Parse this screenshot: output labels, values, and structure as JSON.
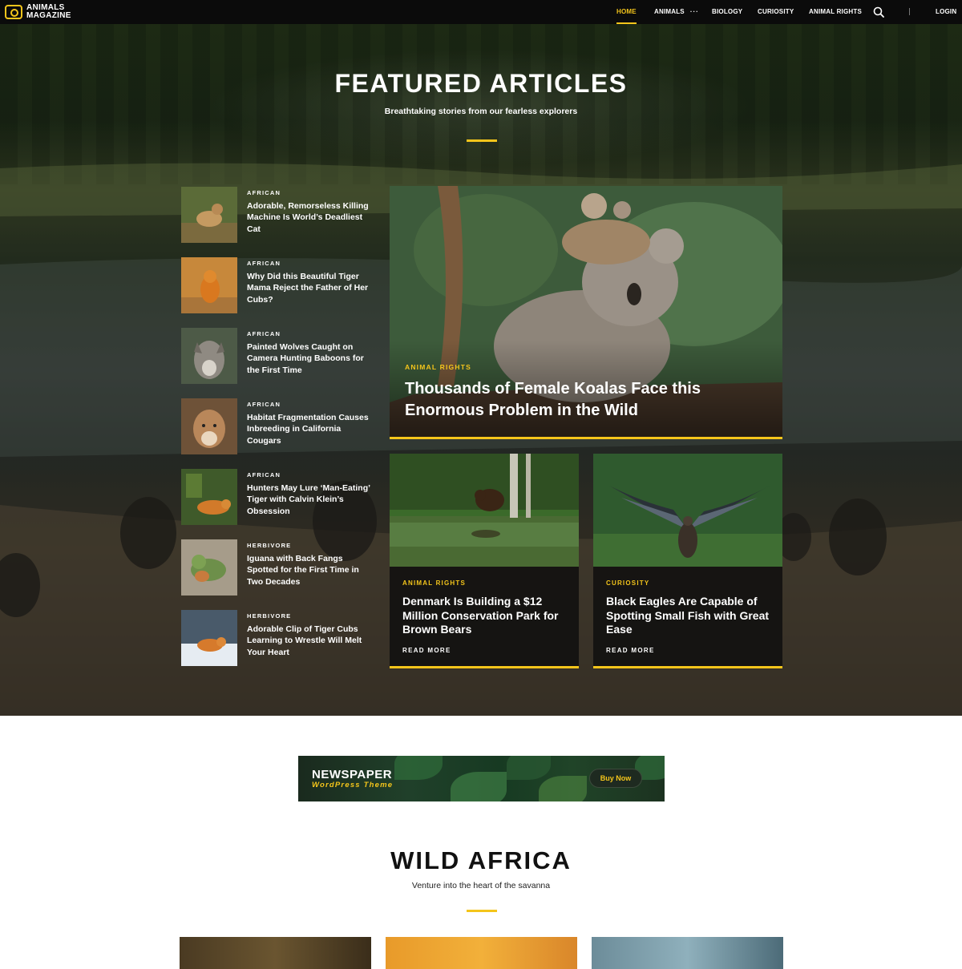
{
  "brand": {
    "line1": "ANIMALS",
    "line2": "MAGAZINE"
  },
  "nav": {
    "items": [
      "HOME",
      "ANIMALS",
      "BIOLOGY",
      "CURIOSITY",
      "ANIMAL RIGHTS"
    ],
    "more": "···",
    "login": "LOGIN"
  },
  "hero": {
    "title": "FEATURED ARTICLES",
    "subtitle": "Breathtaking stories from our fearless explorers"
  },
  "list": [
    {
      "category": "AFRICAN",
      "title": "Adorable, Remorseless Killing Machine Is World’s Deadliest Cat"
    },
    {
      "category": "AFRICAN",
      "title": "Why Did this Beautiful Tiger Mama Reject the Father of Her Cubs?"
    },
    {
      "category": "AFRICAN",
      "title": "Painted Wolves Caught on Camera Hunting Baboons for the First Time"
    },
    {
      "category": "AFRICAN",
      "title": "Habitat Fragmentation Causes Inbreeding in California Cougars"
    },
    {
      "category": "AFRICAN",
      "title": "Hunters May Lure ‘Man-Eating’ Tiger with Calvin Klein’s Obsession"
    },
    {
      "category": "HERBIVORE",
      "title": "Iguana with Back Fangs Spotted for the First Time in Two Decades"
    },
    {
      "category": "HERBIVORE",
      "title": "Adorable Clip of Tiger Cubs Learning to Wrestle Will Melt Your Heart"
    }
  ],
  "feature": {
    "category": "ANIMAL RIGHTS",
    "title": "Thousands of Female Koalas Face this Enormous Problem in the Wild"
  },
  "cards": [
    {
      "category": "ANIMAL RIGHTS",
      "title": "Denmark Is Building a $12 Million Conservation Park for Brown Bears",
      "more": "READ MORE"
    },
    {
      "category": "CURIOSITY",
      "title": "Black Eagles Are Capable of Spotting Small Fish with Great Ease",
      "more": "READ MORE"
    }
  ],
  "ad": {
    "title": "NEWSPAPER",
    "subtitle": "WordPress Theme",
    "button": "Buy Now"
  },
  "wild_africa": {
    "title": "WILD AFRICA",
    "subtitle": "Venture into the heart of the savanna"
  },
  "colors": {
    "accent": "#f4c51b",
    "nav_bg": "#0b0b0b"
  }
}
